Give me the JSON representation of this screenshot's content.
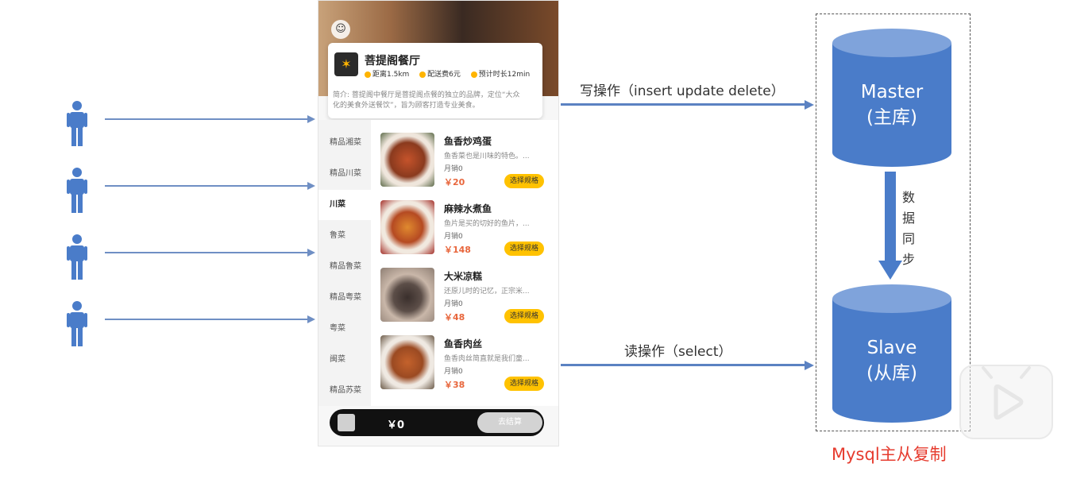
{
  "app": {
    "shop_name": "菩提阁餐厅",
    "distance": "距离1.5km",
    "delivery_fee": "配送费6元",
    "eta": "预计时长12min",
    "intro_line1": "简介: 菩提阁中餐厅是菩提阁点餐的独立的品牌，定位“大众",
    "intro_line2": "化的美食外送餐饮”，旨为顾客打造专业美食。",
    "categories": [
      "精品湘菜",
      "精品川菜",
      "川菜",
      "鲁菜",
      "精品鲁菜",
      "精品粤菜",
      "粤菜",
      "闽菜",
      "精品苏菜"
    ],
    "active_category_index": 2,
    "dishes": [
      {
        "name": "鱼香炒鸡蛋",
        "desc": "鱼香菜也是川味的特色。...",
        "sales": "月销0",
        "price": "￥20",
        "button": "选择规格"
      },
      {
        "name": "麻辣水煮鱼",
        "desc": "鱼片是买的切好的鱼片，...",
        "sales": "月销0",
        "price": "￥148",
        "button": "选择规格"
      },
      {
        "name": "大米凉糕",
        "desc": "还原儿时的记忆，正宗米...",
        "sales": "月销0",
        "price": "￥48",
        "button": "选择规格"
      },
      {
        "name": "鱼香肉丝",
        "desc": "鱼香肉丝简直就是我们童...",
        "sales": "月销0",
        "price": "￥38",
        "button": "选择规格"
      }
    ],
    "cart_total": "￥0",
    "checkout_label": "去结算"
  },
  "diagram": {
    "write_label": "写操作（insert  update  delete）",
    "read_label": "读操作（select）",
    "master_line1": "Master",
    "master_line2": "(主库)",
    "slave_line1": "Slave",
    "slave_line2": "(从库)",
    "sync_label": "数据同步",
    "caption": "Mysql主从复制"
  },
  "colors": {
    "db_fill": "#4a7cc9",
    "db_top": "#7fa3db",
    "arrow": "#5b82c2",
    "caption": "#e63b2e",
    "accent_yellow": "#ffc200"
  }
}
